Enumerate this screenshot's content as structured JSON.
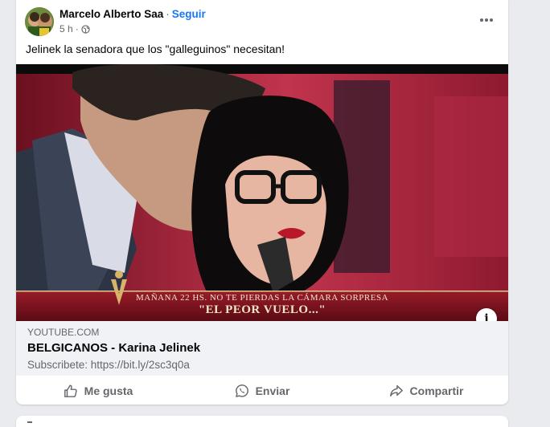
{
  "post": {
    "author": "Marcelo Alberto Saa",
    "separator": "·",
    "follow_label": "Seguir",
    "time": "5 h",
    "time_separator": "·",
    "text": "Jelinek la senadora que los \"galleguinos\" necesitan!",
    "more_icon": "more-horizontal-icon",
    "audience_icon": "globe-icon"
  },
  "media": {
    "banner_line1": "MAÑANA 22 HS. NO TE PIERDAS LA CÁMARA SORPRESA",
    "banner_line2": "\"EL PEOR VUELO...\"",
    "info_label": "i"
  },
  "link": {
    "domain": "YOUTUBE.COM",
    "title": "BELGICANOS - Karina Jelinek",
    "description": "Subscribete: https://bit.ly/2sc3q0a"
  },
  "actions": {
    "like": "Me gusta",
    "send": "Enviar",
    "share": "Compartir"
  },
  "colors": {
    "accent": "#1877f2",
    "secondary_text": "#65676b",
    "link_box_bg": "#f0f2f5"
  }
}
